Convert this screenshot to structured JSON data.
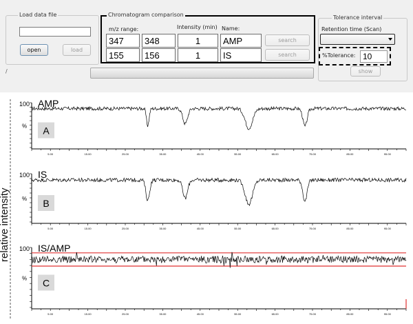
{
  "load_data": {
    "title": "Load data file",
    "file_value": "",
    "open_label": "open",
    "load_label": "load",
    "status_text": "/"
  },
  "comparison": {
    "title": "Chromatogram comparison",
    "col_mz": "m/z range:",
    "col_intensity": "Intensity (min)",
    "col_name": "Name:",
    "rows": [
      {
        "mz_from": "347",
        "mz_to": "348",
        "intensity": "1",
        "name": "AMP",
        "search_label": "search"
      },
      {
        "mz_from": "155",
        "mz_to": "156",
        "intensity": "1",
        "name": "IS",
        "search_label": "search"
      }
    ]
  },
  "tolerance": {
    "title": "Tolerance interval",
    "retention_label": "Retention time (Scan)",
    "retention_value": "",
    "tolerance_label": "%Tolerance:",
    "tolerance_value": "10",
    "show_label": "show"
  },
  "y_axis_label": "relative intensity",
  "chart_data": [
    {
      "type": "line",
      "title": "AMP",
      "panel_letter": "A",
      "y_top_label": "100",
      "y_unit_label": "%",
      "xlim": [
        0,
        100
      ],
      "ylim": [
        0,
        100
      ],
      "x_ticks": [
        "5.00",
        "15.00",
        "25.00",
        "35.00",
        "45.00",
        "55.00",
        "65.00",
        "75.00",
        "85.00",
        "95.00"
      ],
      "baseline": 87,
      "dips": [
        {
          "x": 31,
          "depth": 38,
          "width": 0.5
        },
        {
          "x": 41,
          "depth": 34,
          "width": 0.9
        },
        {
          "x": 58,
          "depth": 44,
          "width": 1.4
        },
        {
          "x": 73,
          "depth": 40,
          "width": 0.8
        }
      ],
      "line_color": "#000000"
    },
    {
      "type": "line",
      "title": "IS",
      "panel_letter": "B",
      "y_top_label": "100",
      "y_unit_label": "%",
      "xlim": [
        0,
        100
      ],
      "ylim": [
        0,
        100
      ],
      "x_ticks": [
        "5.00",
        "15.00",
        "25.00",
        "35.00",
        "45.00",
        "55.00",
        "65.00",
        "75.00",
        "85.00",
        "95.00"
      ],
      "baseline": 87,
      "dips": [
        {
          "x": 31,
          "depth": 42,
          "width": 0.7
        },
        {
          "x": 41,
          "depth": 38,
          "width": 0.9
        },
        {
          "x": 58,
          "depth": 50,
          "width": 1.4
        },
        {
          "x": 73,
          "depth": 44,
          "width": 0.8
        }
      ],
      "line_color": "#000000"
    },
    {
      "type": "line",
      "title": "IS/AMP",
      "panel_letter": "C",
      "y_top_label": "100",
      "y_unit_label": "%",
      "xlim": [
        0,
        100
      ],
      "ylim": [
        0,
        100
      ],
      "x_ticks": [
        "5.00",
        "15.00",
        "25.00",
        "35.00",
        "45.00",
        "55.00",
        "65.00",
        "75.00",
        "85.00",
        "95.00"
      ],
      "baseline": 80,
      "dips": [],
      "tolerance_band": [
        91,
        69
      ],
      "band_color": "#e03030",
      "line_color": "#000000"
    }
  ]
}
